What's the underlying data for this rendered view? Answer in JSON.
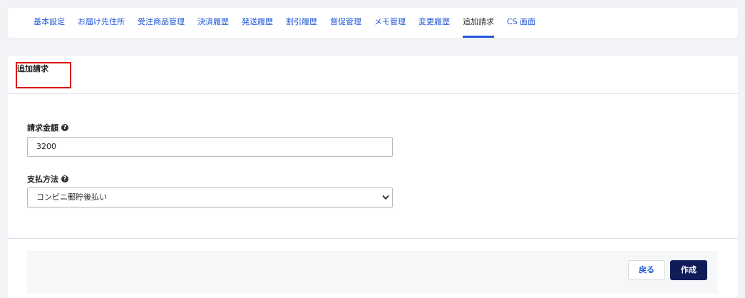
{
  "tabs": [
    {
      "label": "基本設定"
    },
    {
      "label": "お届け先住所"
    },
    {
      "label": "受注商品管理"
    },
    {
      "label": "決済履歴"
    },
    {
      "label": "発送履歴"
    },
    {
      "label": "割引履歴"
    },
    {
      "label": "督促管理"
    },
    {
      "label": "メモ管理"
    },
    {
      "label": "変更履歴"
    },
    {
      "label": "追加請求",
      "active": true
    },
    {
      "label": "CS 画面"
    }
  ],
  "section": {
    "title": "追加請求"
  },
  "form": {
    "amount_label": "請求金額",
    "amount_value": "3200",
    "payment_label": "支払方法",
    "payment_selected": "コンビニ郵貯後払い"
  },
  "icons": {
    "help": "question-circle-icon",
    "dropdown": "chevron-down-icon"
  },
  "actions": {
    "back_label": "戻る",
    "create_label": "作成"
  },
  "colors": {
    "accent": "#2456dc",
    "link": "#1d55d6",
    "primary_button": "#101c57",
    "highlight_border": "#d8090b"
  }
}
